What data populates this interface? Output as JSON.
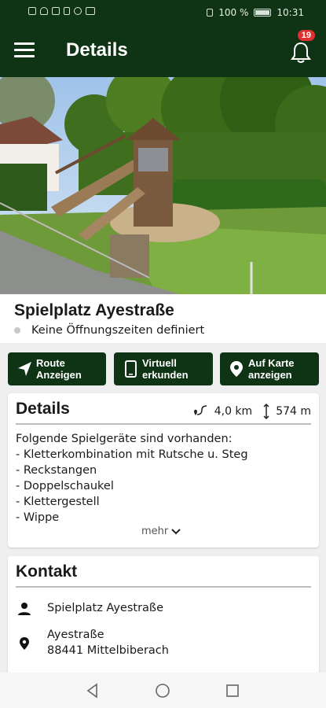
{
  "status_bar": {
    "battery": "100 %",
    "time": "10:31"
  },
  "header": {
    "title": "Details",
    "notifications_count": "19"
  },
  "place": {
    "name": "Spielplatz Ayestraße",
    "opening_hours": "Keine Öffnungszeiten definiert"
  },
  "actions": [
    {
      "icon": "navigation-arrow-icon",
      "label_line1": "Route",
      "label_line2": "Anzeigen"
    },
    {
      "icon": "smartphone-icon",
      "label_line1": "Virtuell",
      "label_line2": "erkunden"
    },
    {
      "icon": "map-pin-icon",
      "label_line1": "Auf Karte",
      "label_line2": "anzeigen"
    }
  ],
  "details": {
    "heading": "Details",
    "distance": "4,0 km",
    "elevation": "574 m",
    "description": [
      "Folgende Spielgeräte sind vorhanden:",
      "- Kletterkombination mit Rutsche u. Steg",
      "- Reckstangen",
      "- Doppelschaukel",
      "- Klettergestell",
      "- Wippe"
    ],
    "more_label": "mehr"
  },
  "contact": {
    "heading": "Kontakt",
    "name": "Spielplatz Ayestraße",
    "street": "Ayestraße",
    "city": "88441 Mittelbiberach"
  },
  "colors": {
    "primary": "#0f3315",
    "badge": "#e0302f"
  }
}
